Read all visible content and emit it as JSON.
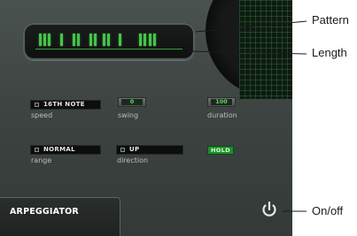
{
  "pattern_steps": [
    1,
    1,
    1,
    1,
    1,
    1,
    1,
    1,
    1,
    1,
    1,
    1,
    1,
    1,
    1
  ],
  "controls": {
    "speed": {
      "value": "16TH NOTE",
      "label": "speed"
    },
    "swing": {
      "value": "0",
      "label": "swing"
    },
    "duration": {
      "value": "100",
      "label": "duration"
    },
    "range": {
      "value": "NORMAL",
      "label": "range"
    },
    "direction": {
      "value": "UP",
      "label": "direction"
    },
    "hold": {
      "label": "HOLD"
    }
  },
  "tab": {
    "label": "ARPEGGIATOR"
  },
  "icons": {
    "power": "power-icon"
  },
  "callouts": {
    "pattern": "Pattern",
    "length": "Length",
    "on_off": "On/off"
  },
  "colors": {
    "led_green": "#46c34a",
    "hold_green": "#1e8f2c",
    "panel": "#3d4442"
  }
}
